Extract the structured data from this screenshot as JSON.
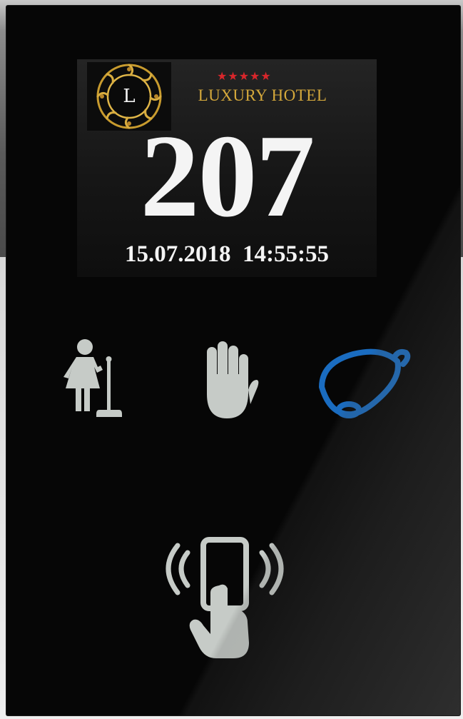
{
  "hotel": {
    "logo_letter": "L",
    "stars": "★★★★★",
    "name": "LUXURY HOTEL"
  },
  "room": {
    "number": "207",
    "date": "15.07.2018",
    "time": "14:55:55"
  },
  "controls": [
    {
      "id": "housekeeping",
      "icon": "housekeeping-maid-icon",
      "active": false,
      "color": "#c6cbc7"
    },
    {
      "id": "do-not-disturb",
      "icon": "hand-stop-icon",
      "active": false,
      "color": "#c6cbc7"
    },
    {
      "id": "call-service",
      "icon": "bell-icon",
      "active": true,
      "color": "#1a6cc0"
    },
    {
      "id": "key-card",
      "icon": "key-card-reader-icon",
      "active": false,
      "color": "#c6cbc7"
    }
  ],
  "colors": {
    "icon_idle": "#c6cbc7",
    "icon_active": "#1a6cc0",
    "brand_gold": "#d4a83b",
    "stars_red": "#d8262b"
  }
}
